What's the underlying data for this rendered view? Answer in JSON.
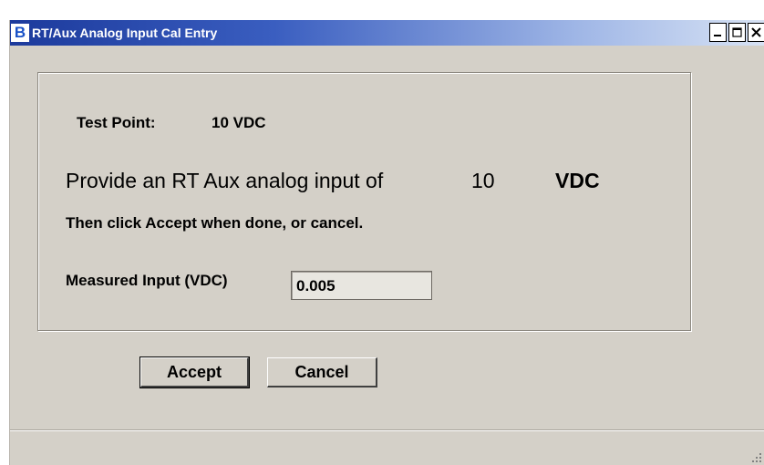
{
  "window": {
    "title": "RT/Aux Analog Input Cal Entry",
    "icon_text": "B",
    "icon": "app-logo-icon",
    "title_buttons": [
      "minimize-icon",
      "maximize-icon",
      "close-icon"
    ],
    "accent_color": "#1c3a9c",
    "background_color": "#d4d0c8"
  },
  "test_point": {
    "label": "Test Point:",
    "value": "10 VDC"
  },
  "prompt": {
    "text": "Provide an RT Aux analog input of",
    "value": "10",
    "unit": "VDC"
  },
  "instruction": "Then click Accept when done, or cancel.",
  "measured": {
    "label": "Measured Input (VDC)",
    "value": "0.005"
  },
  "buttons": {
    "accept": "Accept",
    "cancel": "Cancel"
  }
}
